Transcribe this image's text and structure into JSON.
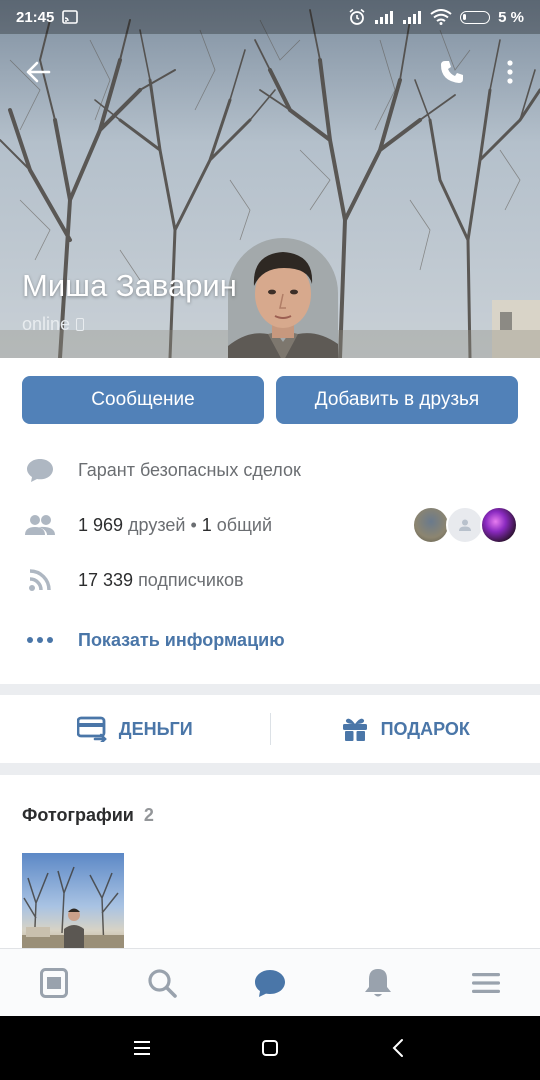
{
  "status_bar": {
    "time": "21:45",
    "battery": "5 %"
  },
  "profile": {
    "name": "Миша Заварин",
    "status": "online"
  },
  "buttons": {
    "message": "Сообщение",
    "add_friend": "Добавить в друзья"
  },
  "info": {
    "status_text": "Гарант безопасных сделок",
    "friends_count": "1 969",
    "friends_label": " друзей • ",
    "mutual_count": "1",
    "mutual_label": " общий",
    "subscribers_count": "17 339",
    "subscribers_label": " подписчиков",
    "show_info": "Показать информацию"
  },
  "actions": {
    "money": "ДЕНЬГИ",
    "gift": "ПОДАРОК"
  },
  "photos": {
    "title": "Фотографии",
    "count": "2"
  },
  "colors": {
    "accent": "#5181b8",
    "link": "#4a76a8",
    "active_tab": "#4a76a8"
  }
}
